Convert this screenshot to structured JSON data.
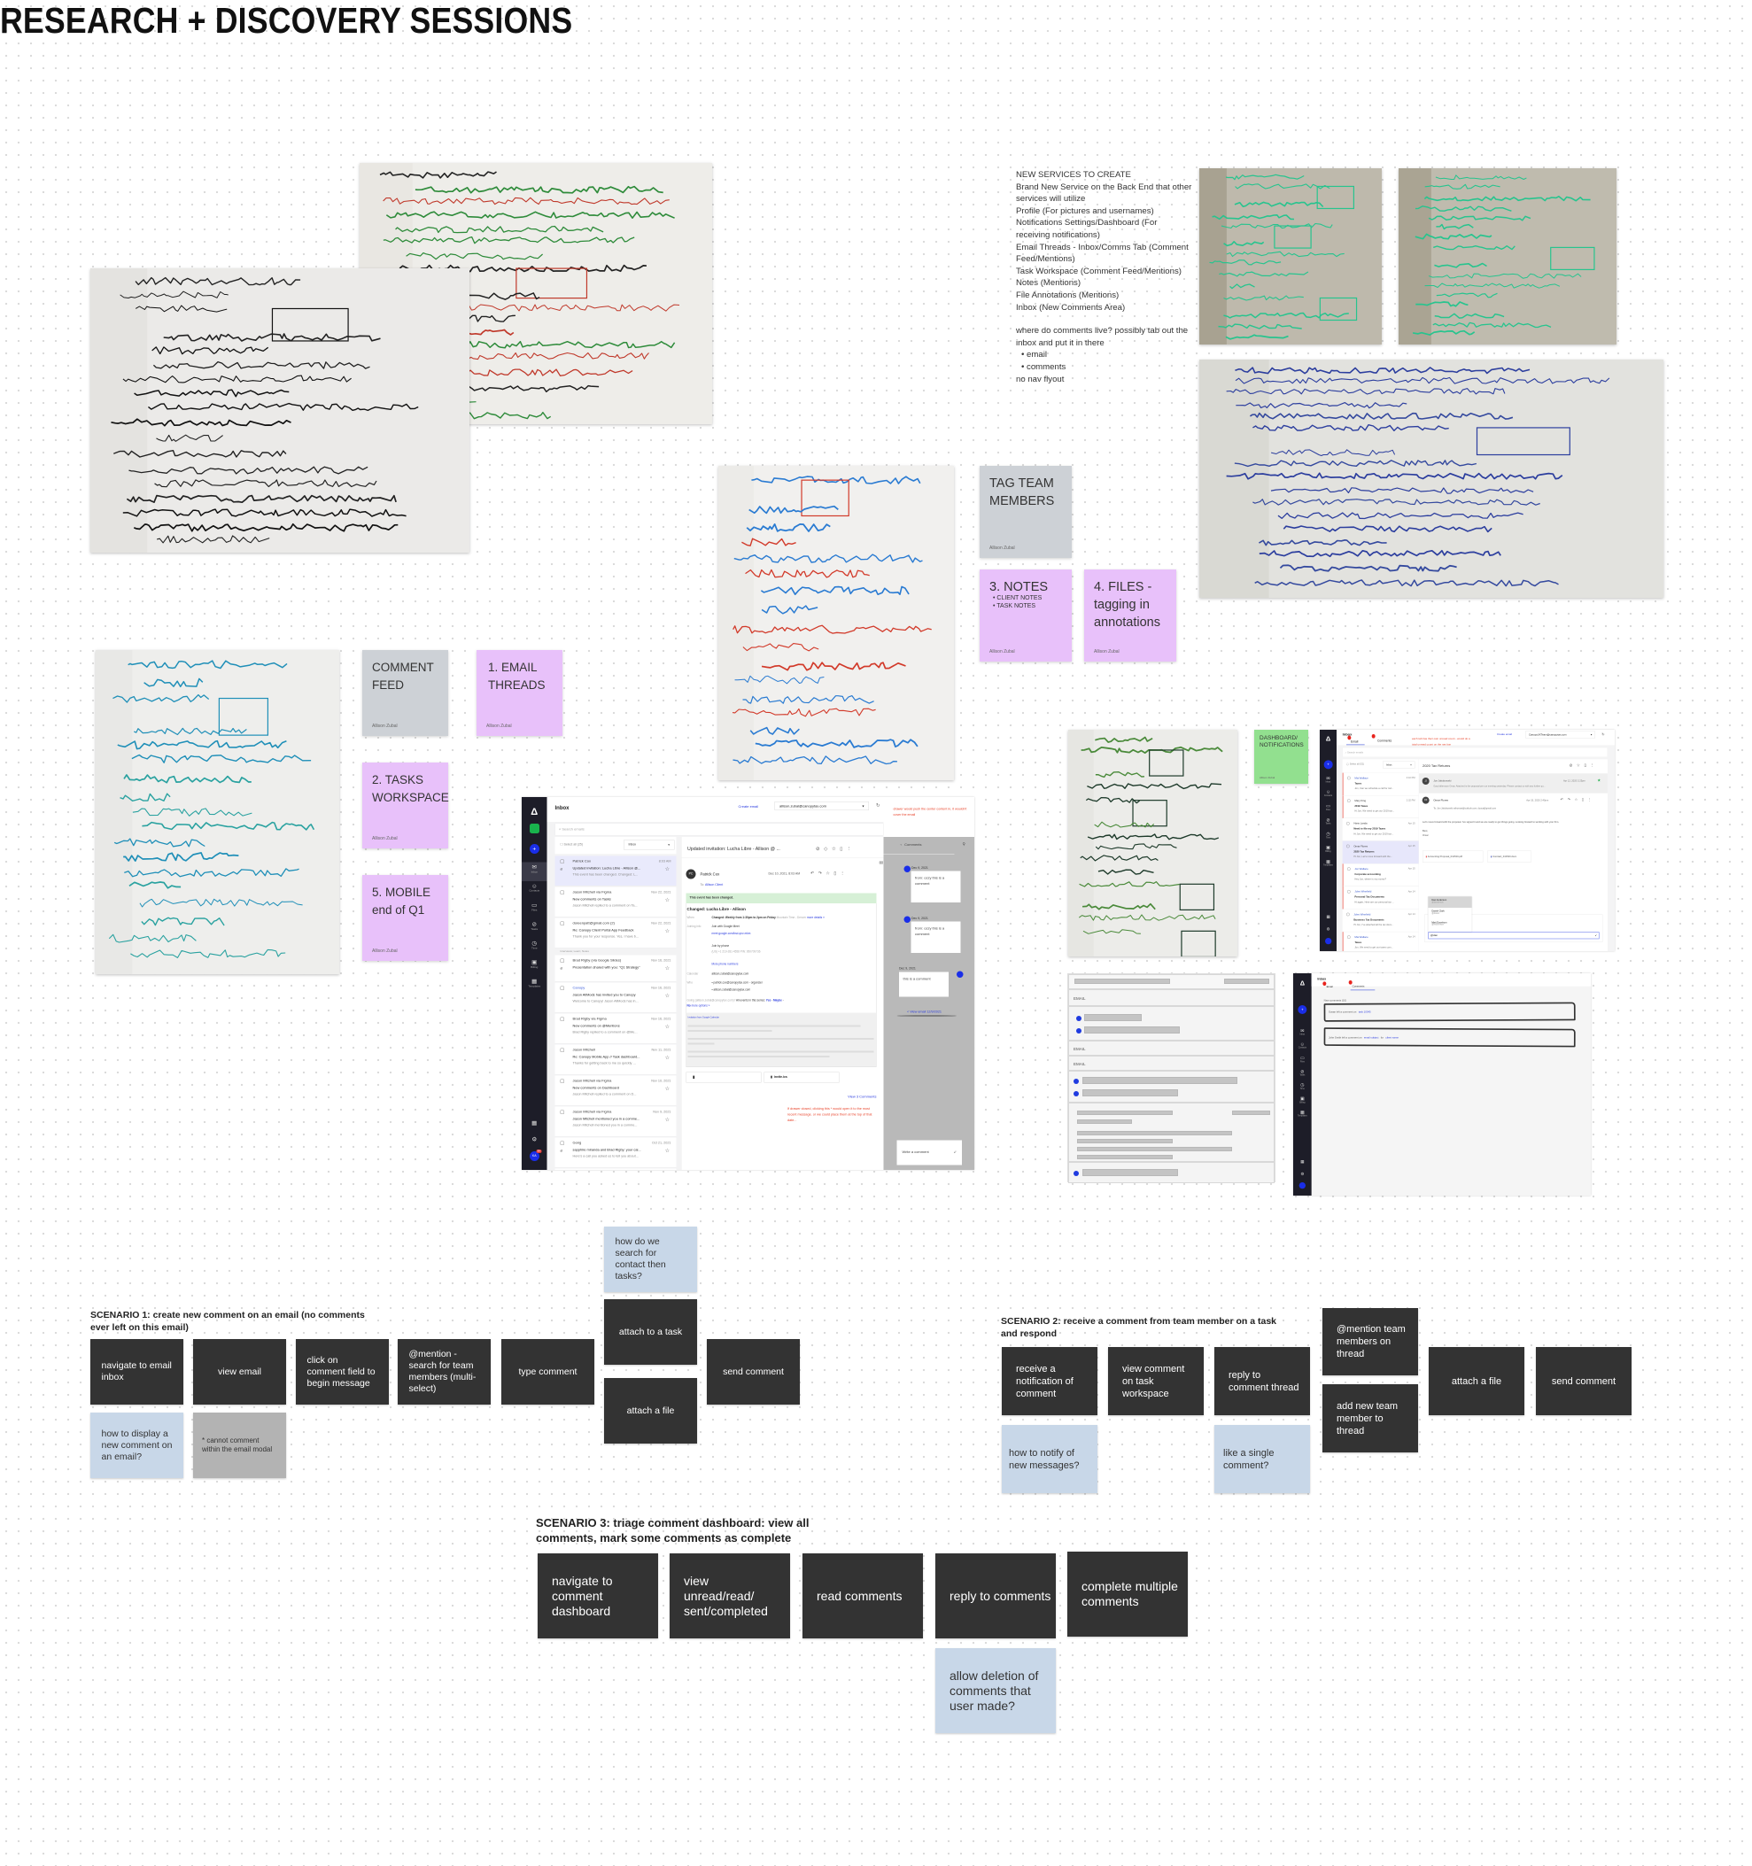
{
  "title": "RESEARCH + DISCOVERY SESSIONS",
  "colors": {
    "sticky_gray": "#cdd1d6",
    "sticky_pink": "#e8c1fa",
    "sticky_green": "#92e08f",
    "step_dark": "#333333",
    "question_blue": "#c8d7e8",
    "note_gray": "#b3b3b3",
    "annotation_red": "#e8432a",
    "brand_blue": "#1a2ee8"
  },
  "photos": [
    {
      "id": "email-inbox-whiteboard-back",
      "ink": [
        "#c0392b",
        "#2e8b3a",
        "#222"
      ],
      "bg": "#e9e7e2"
    },
    {
      "id": "email-inbox-whiteboard-front",
      "ink": [
        "#111",
        "#222"
      ],
      "bg": "#e4e3e0"
    },
    {
      "id": "comments-whiteboard",
      "ink": [
        "#27c48e"
      ],
      "bg": "#a8a291"
    },
    {
      "id": "notify-comments-whiteboard",
      "ink": [
        "#27c48e"
      ],
      "bg": "#aaa493"
    },
    {
      "id": "dashboard-whiteboard",
      "ink": [
        "#2c3e9e",
        "#34499e"
      ],
      "bg": "#d9d9d3"
    },
    {
      "id": "tagging-team-member-whiteboard",
      "ink": [
        "#d23a2a",
        "#2a7bd2"
      ],
      "bg": "#ecebe8"
    },
    {
      "id": "comment-feed-whiteboard",
      "ink": [
        "#1f8fb8",
        "#2aa2a0"
      ],
      "bg": "#e8e8e6"
    },
    {
      "id": "comments-dashboard-notifications-whiteboard",
      "ink": [
        "#1d3a2a",
        "#4a8a3a"
      ],
      "bg": "#e6e6e2"
    }
  ],
  "services_notes": {
    "lines": [
      "NEW SERVICES TO CREATE",
      "Brand New Service on the Back End that other services will utilize",
      "Profile (For pictures and usernames)",
      "Notifications Settings/Dashboard (For receiving notifications)",
      "Email Threads - Inbox/Comms Tab (Comment Feed/Mentions)",
      "Task Workspace (Comment Feed/Mentions)",
      "Notes (Mentions)",
      "File Annotations (Mentions)",
      "Inbox (New Comments Area)"
    ],
    "question": "where do comments live? possibly tab out the inbox and put it in there",
    "bullets": [
      "email",
      "comments"
    ],
    "footer": "no nav flyout"
  },
  "stickies": {
    "author": "Allison Zubal",
    "tag_team": "TAG TEAM MEMBERS",
    "notes": "3. NOTES",
    "notes_bullets": [
      "CLIENT NOTES",
      "TASK NOTES"
    ],
    "files": "4. FILES - tagging in annotations",
    "comment_feed": "COMMENT FEED",
    "email_threads": "1. EMAIL THREADS",
    "tasks": "2. TASKS WORKSPACE",
    "mobile": "5. MOBILE end of Q1",
    "dashboard": "DASHBOARD/ NOTIFICATIONS"
  },
  "nav": [
    "Inbox",
    "Contacts",
    "Files",
    "Tasks",
    "Time",
    "Billing",
    "Templates"
  ],
  "mock1": {
    "title": "Inbox",
    "create": "Create email",
    "account": "allison.zubal@canopytax.com",
    "search": "Search emails",
    "select_all": "Select all (25)",
    "filter": "Inbox",
    "avatar": "KA",
    "badge": "99+",
    "group_label": "Interviews; Learn; Notes",
    "items": [
      {
        "sender": "Patrick Cox",
        "date": "8:03 AM",
        "subject": "Updated invitation: Lucha Libre - Allison @...",
        "preview": "This event has been changed. Changed: L...",
        "clip": true,
        "selected": true
      },
      {
        "sender": "Jason Mitchell via Figma",
        "date": "Nov 22, 2021",
        "subject": "New comments on Tasks",
        "preview": "Jason Mitchell replied to a comment on Ta..."
      },
      {
        "sender": "doreenpatt@gmail.com (2)",
        "date": "Nov 22, 2021",
        "subject": "Re: Canopy Client Portal App Feedback",
        "preview": "Thank you for your response. Yes, I have b..."
      },
      {
        "sender": "Brad Rigby (via Google Slides)",
        "date": "Nov 16, 2021",
        "subject": "Presentation shared with you: \"Q1 Strategy\"",
        "preview": "",
        "clip": true,
        "group": true
      },
      {
        "sender": "Canopy",
        "date": "Nov 16, 2021",
        "subject": "Jason AllMods has invited you to Canopy",
        "preview": "Welcome to Canopy! Jason AllMods has in...",
        "blue": true
      },
      {
        "sender": "Brad Rigby via Figma",
        "date": "Nov 16, 2021",
        "subject": "New comments on @Mentions",
        "preview": "Brad Rigby replied to a comment on @Me..."
      },
      {
        "sender": "Jason Mitchell",
        "date": "Nov 11, 2021",
        "subject": "Re: Canopy Mobile App // Task dashboard...",
        "preview": "Thanks for getting back to me so quickly. ..."
      },
      {
        "sender": "Jason Mitchell via Figma",
        "date": "Nov 10, 2021",
        "subject": "New comments on Dashboard",
        "preview": "Jason Mitchell replied to a comment on D..."
      },
      {
        "sender": "Jason Mitchell via Figma",
        "date": "Nov 9, 2021",
        "subject": "Jason Mitchell mentioned you in a comme...",
        "preview": "Jason Mitchell mentioned you in a comme..."
      },
      {
        "sender": "Gong",
        "date": "Oct 21, 2021",
        "subject": "sapphire miranda and Brad Rigby: your cal...",
        "preview": "Here's a call you asked us to tell you about...",
        "clip": true
      },
      {
        "sender": "Jason Mitchell",
        "date": "Oct 15, 2021",
        "subject": "",
        "preview": ""
      }
    ],
    "email": {
      "subject": "Updated invitation: Lucha Libre - Allison @ ...",
      "initials": "PC",
      "from": "Patrick Cox",
      "date": "Dec 10, 2021, 8:03 AM",
      "to_label": "To:",
      "to": "Allison Client",
      "banner": "This event has been changed.",
      "heading": "Changed: Lucha Libre - Allison",
      "when_label": "When",
      "when": "Changed: Weekly from 1:30pm to 2pm on Friday",
      "when_tz": "Mountain Time - Denver",
      "more_details": "more details »",
      "join_label": "Joining info",
      "join": "Join with Google Meet",
      "meet": "meet.google.com/ksd-qnv-mkm",
      "phone_label": "Join by phone",
      "phone": "(US) +1 219-281-4558 PIN: 950709736",
      "more_phone": "More phone numbers",
      "cal_label": "Calendar",
      "calendar": "allison.zubal@canopytax.com",
      "who_label": "Who",
      "who": [
        "patrick.cox@canopytax.com - organizer",
        "allison.zubal@canopytax.com"
      ],
      "going": "Going (allison.zubal@canopytax.com)?",
      "series": "All events in this series:",
      "yes": "Yes",
      "maybe": "Maybe",
      "no": "No",
      "more_options": "more options »",
      "invitation": "Invitation from Google Calendar",
      "attachment": "invite.ics",
      "view_comments": "View 3 Comments"
    },
    "note_drawer": "drawer would push the center content in, it wouldn't cover the email",
    "note_view": "If drawer closed, clicking this * would open it to the most recent message. or we could place them at the top of that date...",
    "drawer": {
      "title": "Comments",
      "comments": [
        {
          "date": "Dec 9, 2021",
          "text": "from: ozzy this is a comment"
        },
        {
          "date": "Dec 9, 2021",
          "text": "from: ozzy this is a comment"
        },
        {
          "date": "Dec 9, 2021",
          "text": "this is a comment"
        }
      ],
      "view_email": "< View email 12/9/2021",
      "write": "Write a comment"
    }
  },
  "mock2": {
    "title": "Inbox",
    "tabs": [
      "Email",
      "Comments"
    ],
    "create": "Create email",
    "account": "CanopyUXTeam@canopytax.com",
    "search": "Search emails",
    "select_all": "Select all (52)",
    "filter": "Inbox",
    "note": "each tab has their own unread count - would do a total unread count on the nav bar",
    "subject": "2020 Tax Returns",
    "items": [
      {
        "sender": "Mia Wallace",
        "date": "4:10 PM",
        "subject": "Taxes",
        "preview": "Jon, Can we schedule a call for tod...",
        "unread": true,
        "blue": true
      },
      {
        "sender": "Mary King",
        "date": "2:32 PM",
        "subject": "2019 Taxes",
        "preview": "Hi Jon, We need to get our 2019 tax...",
        "unread": true
      },
      {
        "sender": "Hans Landa",
        "date": "Apr 15",
        "subject": "Need to file my 2019 Taxes",
        "preview": "Hi Jon, We need to get our 2019 tax..."
      },
      {
        "sender": "Omar Flores",
        "date": "Apr 15",
        "subject": "2020 Tax Returns",
        "preview": "Hi Jon, Let's move forward with the...",
        "selected": true
      },
      {
        "sender": "Jon Wallace",
        "date": "Apr 15",
        "subject": "Corporate accounting",
        "preview": "Hey Jon, where is my money?",
        "unread": true,
        "blue": true
      },
      {
        "sender": "Jules Winnfield",
        "date": "Apr 14",
        "subject": "Personal Tax Documents",
        "preview": "Hi again, Here are our personal tax ...",
        "unread": true,
        "blue": true
      },
      {
        "sender": "Jules Winnfield",
        "date": "Apr 14",
        "subject": "Business Tax Documents",
        "preview": "Hi Jon, I've attached all the tax docs...",
        "blue": true
      },
      {
        "sender": "Mia Wallace",
        "date": "Apr 14",
        "subject": "Taxes",
        "preview": "Jon, We need to get our taxes com...",
        "unread": true,
        "blue": true
      }
    ],
    "msg1": {
      "initials": "JJ",
      "from": "Jon Jakubowski",
      "date": "Apr 12, 2020 2:25pm",
      "body": "Good afternoon Omar, Attached is the proposal per our meeting yesterday. Please contact us with any further qu..."
    },
    "msg2": {
      "initials": "OF",
      "from": "Omar Flores",
      "date": "Apr 15, 2020 2:40pm",
      "to": "To: Jon Jakubowski railroman@outlook.com; dyoca@gmail.com",
      "body": "Let's move forward with the proposal. I've signed it and we are ready to get things going. Looking forward to working with your firm.",
      "sign1": "Best,",
      "sign2": "Omar"
    },
    "attachments": [
      "Accounting Proposal_041520.pdf",
      "Contract_041520.docx"
    ],
    "mentions": [
      {
        "name": "Dan Anderson",
        "handle": "@danderson"
      },
      {
        "name": "Daniel Clark",
        "handle": "@dclark"
      },
      {
        "name": "Matt Donelson",
        "handle": "@mdonelson"
      }
    ],
    "input": "@dan"
  },
  "wire": {
    "labels": [
      "EMAIL",
      "EMAIL",
      "EMAIL"
    ]
  },
  "mock3": {
    "title": "Inbox",
    "tabs": [
      "Email",
      "Comments"
    ],
    "heading": "New comments (10)",
    "c1": {
      "text": "Susan left a comment on",
      "link": "task 10345"
    },
    "c2": {
      "text": "John Smith left a comment on",
      "link": "email subject",
      "mid": "for",
      "link2": "client name"
    }
  },
  "scenario1": {
    "title": "SCENARIO 1: create new comment on an email (no comments ever left on this email)",
    "steps": [
      "navigate to email inbox",
      "view email",
      "click on comment field to begin message",
      "@mention - search for team members (multi-select)",
      "type comment",
      "attach to a task",
      "attach a file",
      "send comment"
    ],
    "questions": [
      "how do we search for contact then tasks?",
      "how to display a new comment on an email?"
    ],
    "note": "* cannot comment within the email modal"
  },
  "scenario2": {
    "title": "SCENARIO 2: receive a comment from team member on a task and respond",
    "steps": [
      "receive a notification of comment",
      "view comment on task workspace",
      "reply to comment thread",
      "@mention team members on thread",
      "add new team member to thread",
      "attach a file",
      "send comment"
    ],
    "questions": [
      "how to notify of new messages?",
      "like a single comment?"
    ]
  },
  "scenario3": {
    "title": "SCENARIO 3: triage comment dashboard: view all comments, mark some comments as complete",
    "steps": [
      "navigate to comment dashboard",
      "view unread/read/ sent/completed",
      "read comments",
      "reply to comments",
      "complete multiple comments"
    ],
    "questions": [
      "allow deletion of comments that user made?"
    ]
  }
}
